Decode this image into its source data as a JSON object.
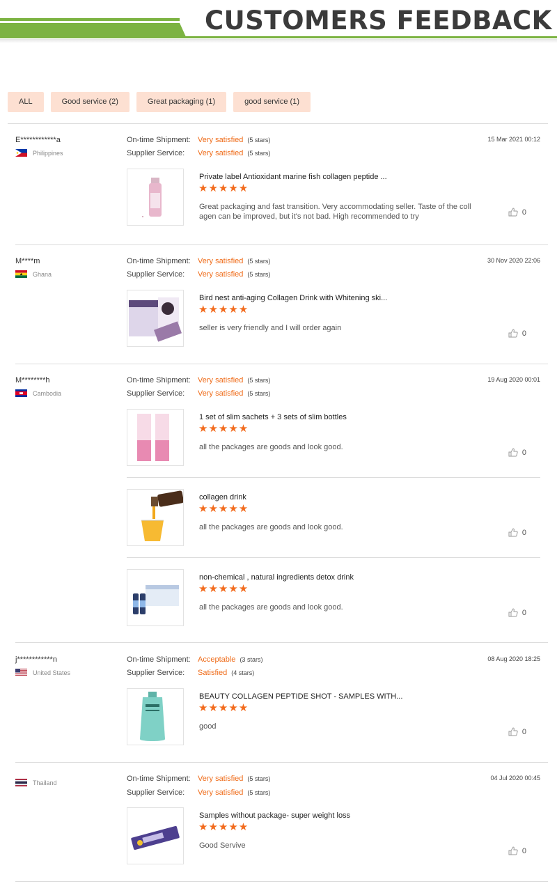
{
  "header": {
    "title": "CUSTOMERS FEEDBACK"
  },
  "filters": [
    {
      "label": "ALL"
    },
    {
      "label": "Good service (2)"
    },
    {
      "label": "Great packaging (1)"
    },
    {
      "label": "good service (1)"
    }
  ],
  "labels": {
    "shipment": "On-time Shipment:",
    "service": "Supplier Service:"
  },
  "colors": {
    "accent": "#ef6c1a",
    "brand_green": "#7cb342",
    "tag_bg": "#fde0d2"
  },
  "reviews": [
    {
      "name": "E************a",
      "country": "Philippines",
      "flag": "philippines-flag-icon",
      "date": "15 Mar 2021 00:12",
      "shipment": {
        "value": "Very satisfied",
        "stars": "(5 stars)"
      },
      "service": {
        "value": "Very satisfied",
        "stars": "(5 stars)"
      },
      "products": [
        {
          "title": "Private label Antioxidant marine fish collagen peptide ...",
          "stars": "★★★★★",
          "rating": 5,
          "comment": "Great packaging and fast transition. Very accommodating seller. Taste of the coll agen can be improved, but it's not bad. High recommended to try",
          "likes": "0"
        }
      ]
    },
    {
      "name": "M****m",
      "country": "Ghana",
      "flag": "ghana-flag-icon",
      "date": "30 Nov 2020 22:06",
      "shipment": {
        "value": "Very satisfied",
        "stars": "(5 stars)"
      },
      "service": {
        "value": "Very satisfied",
        "stars": "(5 stars)"
      },
      "products": [
        {
          "title": "Bird nest anti-aging Collagen Drink with Whitening ski...",
          "stars": "★★★★★",
          "rating": 5,
          "comment": "seller is very friendly and I will order again",
          "likes": "0"
        }
      ]
    },
    {
      "name": "M********h",
      "country": "Cambodia",
      "flag": "cambodia-flag-icon",
      "date": "19 Aug 2020 00:01",
      "shipment": {
        "value": "Very satisfied",
        "stars": "(5 stars)"
      },
      "service": {
        "value": "Very satisfied",
        "stars": "(5 stars)"
      },
      "products": [
        {
          "title": "1 set of slim sachets + 3 sets of slim bottles",
          "stars": "★★★★★",
          "rating": 5,
          "comment": "all the packages are goods and look good.",
          "likes": "0"
        },
        {
          "title": "collagen drink",
          "stars": "★★★★★",
          "rating": 5,
          "comment": "all the packages are goods and look good.",
          "likes": "0"
        },
        {
          "title": "non-chemical , natural ingredients detox drink",
          "stars": "★★★★★",
          "rating": 5,
          "comment": "all the packages are goods and look good.",
          "likes": "0"
        }
      ]
    },
    {
      "name": "j************n",
      "country": "United States",
      "flag": "usa-flag-icon",
      "date": "08 Aug 2020 18:25",
      "shipment": {
        "value": "Acceptable",
        "stars": "(3 stars)"
      },
      "service": {
        "value": "Satisfied",
        "stars": "(4 stars)"
      },
      "products": [
        {
          "title": "BEAUTY COLLAGEN PEPTIDE SHOT - SAMPLES WITH...",
          "stars": "★★★★★",
          "rating": 5,
          "comment": "good",
          "likes": "0"
        }
      ]
    },
    {
      "name": "",
      "country": "Thailand",
      "flag": "thailand-flag-icon",
      "date": "04 Jul 2020 00:45",
      "shipment": {
        "value": "Very satisfied",
        "stars": "(5 stars)"
      },
      "service": {
        "value": "Very satisfied",
        "stars": "(5 stars)"
      },
      "products": [
        {
          "title": "Samples without package- super weight loss",
          "stars": "★★★★★",
          "rating": 5,
          "comment": "Good Servive",
          "likes": "0"
        }
      ]
    }
  ]
}
